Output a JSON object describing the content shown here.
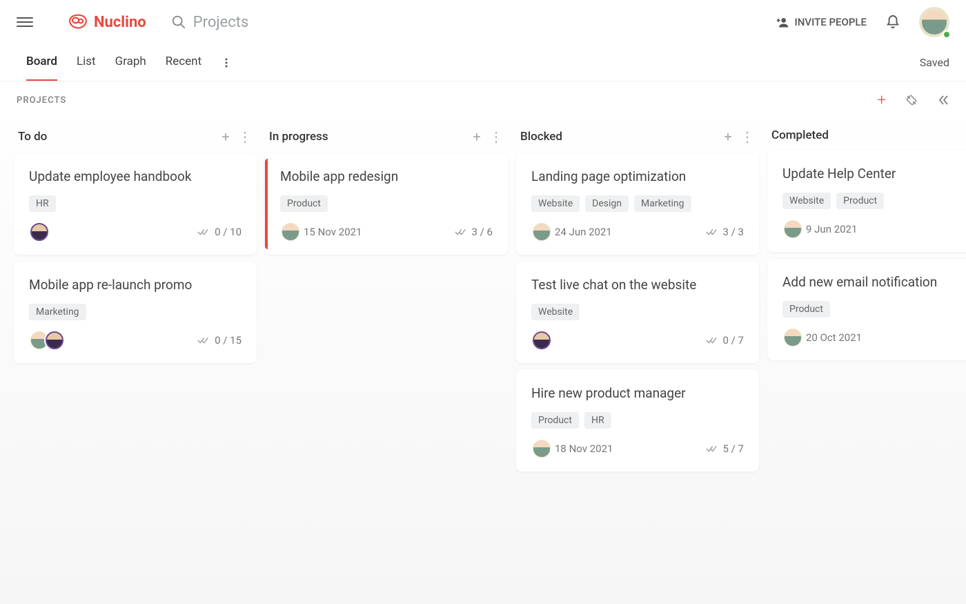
{
  "header": {
    "brand": "Nuclino",
    "search_placeholder": "Projects",
    "invite_label": "INVITE PEOPLE"
  },
  "tabs": {
    "items": [
      "Board",
      "List",
      "Graph",
      "Recent"
    ],
    "active": "Board",
    "saved_label": "Saved"
  },
  "subheader": {
    "section_label": "PROJECTS"
  },
  "columns": [
    {
      "title": "To do",
      "show_actions": true,
      "cards": [
        {
          "title": "Update employee handbook",
          "tags": [
            "HR"
          ],
          "avatars": [
            "u2"
          ],
          "progress": "0 / 10"
        },
        {
          "title": "Mobile app re-launch promo",
          "tags": [
            "Marketing"
          ],
          "avatars": [
            "u1",
            "u2"
          ],
          "progress": "0 / 15"
        }
      ]
    },
    {
      "title": "In progress",
      "show_actions": true,
      "cards": [
        {
          "title": "Mobile app redesign",
          "tags": [
            "Product"
          ],
          "avatars": [
            "u1"
          ],
          "date": "15 Nov 2021",
          "progress": "3 / 6",
          "accent": true
        }
      ]
    },
    {
      "title": "Blocked",
      "show_actions": true,
      "cards": [
        {
          "title": "Landing page optimization",
          "tags": [
            "Website",
            "Design",
            "Marketing"
          ],
          "avatars": [
            "u1"
          ],
          "date": "24 Jun 2021",
          "progress": "3 / 3"
        },
        {
          "title": "Test live chat on the website",
          "tags": [
            "Website"
          ],
          "avatars": [
            "u2"
          ],
          "progress": "0 / 7"
        },
        {
          "title": "Hire new product manager",
          "tags": [
            "Product",
            "HR"
          ],
          "avatars": [
            "u1"
          ],
          "date": "18 Nov 2021",
          "progress": "5 / 7"
        }
      ]
    },
    {
      "title": "Completed",
      "show_actions": false,
      "cards": [
        {
          "title": "Update Help Center",
          "tags": [
            "Website",
            "Product"
          ],
          "avatars": [
            "u1"
          ],
          "date": "9 Jun 2021"
        },
        {
          "title": "Add new email notification",
          "tags": [
            "Product"
          ],
          "avatars": [
            "u1"
          ],
          "date": "20 Oct 2021"
        }
      ]
    }
  ]
}
